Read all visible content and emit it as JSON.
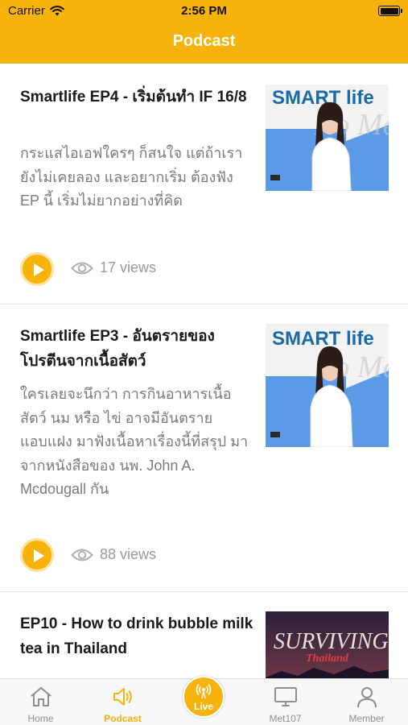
{
  "status_bar": {
    "carrier": "Carrier",
    "time": "2:56 PM"
  },
  "header": {
    "title": "Podcast"
  },
  "feed": [
    {
      "title": "Smartlife EP4 - เริ่มต้นทำ IF 16/8",
      "description": "กระแสไอเอฟใครๆ ก็สนใจ แต่ถ้าเรายังไม่เคยลอง และอยากเริ่ม ต้องฟัง EP นี้ เริ่มไม่ยากอย่างที่คิด",
      "views": "17 views",
      "thumb_brand": "SMART life",
      "thumb_sub": "No Mee"
    },
    {
      "title": "Smartlife EP3 - อันตรายของโปรตีนจากเนื้อสัตว์",
      "description": "ใครเลยจะนึกว่า การกินอาหารเนื้อสัตว์ นม หรือ ไข่ อาจมีอันตราย แอบแฝง มาฟังเนื้อหาเรื่องนี้ที่สรุป มาจากหนังสือของ นพ. John A. Mcdougall กัน",
      "views": "88 views",
      "thumb_brand": "SMART life",
      "thumb_sub": "No Mee"
    },
    {
      "title": "EP10 - How to drink bubble milk tea in Thailand",
      "thumb_brand": "SURVIVING",
      "thumb_sub": "Thailand"
    }
  ],
  "tabbar": {
    "items": [
      {
        "label": "Home",
        "icon": "home-icon"
      },
      {
        "label": "Podcast",
        "icon": "speaker-icon"
      },
      {
        "label": "Live",
        "icon": "broadcast-icon"
      },
      {
        "label": "Met107",
        "icon": "monitor-icon"
      },
      {
        "label": "Member",
        "icon": "person-icon"
      }
    ]
  },
  "colors": {
    "accent": "#f6b30c",
    "text_primary": "#1a1a1a",
    "text_secondary": "#7a7a7a",
    "muted": "#9a9a9a"
  }
}
